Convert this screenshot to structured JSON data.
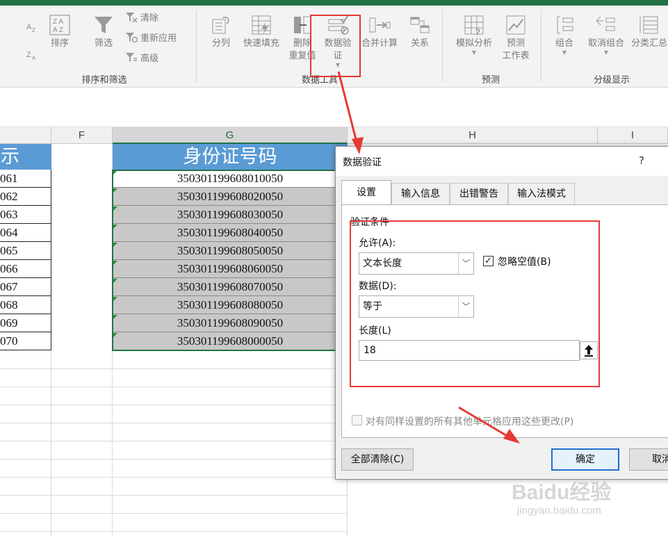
{
  "ribbon": {
    "sort_buttons": {
      "az": "A Z",
      "za": "Z A"
    },
    "sort_label": "排序",
    "filter_label": "筛选",
    "clear_label": "清除",
    "reapply_label": "重新应用",
    "advanced_label": "高级",
    "group_sort_filter": "排序和筛选",
    "split_label": "分列",
    "flash_fill_label": "快速填充",
    "remove_dup_line1": "删除",
    "remove_dup_line2": "重复值",
    "data_valid_line1": "数据验",
    "data_valid_line2": "证",
    "consolidate_label": "合并计算",
    "relations_label": "关系",
    "group_data_tools": "数据工具",
    "whatif_label": "模拟分析",
    "forecast_line1": "预测",
    "forecast_line2": "工作表",
    "group_forecast": "预测",
    "group_label": "组合",
    "ungroup_label": "取消组合",
    "subtotal_label": "分类汇总",
    "group_outline": "分级显示"
  },
  "grid": {
    "columns": [
      "F",
      "G",
      "H",
      "I"
    ],
    "e_header": "显示",
    "g_header": "身份证号码",
    "e_values": [
      "061",
      "062",
      "063",
      "064",
      "065",
      "066",
      "067",
      "068",
      "069",
      "070"
    ],
    "g_values": [
      "350301199608010050",
      "350301199608020050",
      "350301199608030050",
      "350301199608040050",
      "350301199608050050",
      "350301199608060050",
      "350301199608070050",
      "350301199608080050",
      "350301199608090050",
      "350301199608000050"
    ]
  },
  "dialog": {
    "title": "数据验证",
    "help": "?",
    "tabs": [
      "设置",
      "输入信息",
      "出错警告",
      "输入法模式"
    ],
    "section": "验证条件",
    "allow_label": "允许(A):",
    "allow_value": "文本长度",
    "ignore_blank_label": "忽略空值(B)",
    "ignore_blank_checked": true,
    "data_label": "数据(D):",
    "data_value": "等于",
    "length_label": "长度(L)",
    "length_value": "18",
    "apply_all_label": "对有同样设置的所有其他单元格应用这些更改(P)",
    "clear_all_button": "全部清除(C)",
    "ok_button": "确定",
    "cancel_button": "取消"
  },
  "watermark": {
    "main": "Baidu经验",
    "sub": "jingyan.baidu.com"
  },
  "colors": {
    "excel_green": "#217346",
    "header_blue": "#5b9bd5",
    "annotation_red": "#e53935",
    "selection_gray": "#c8c8c8"
  }
}
